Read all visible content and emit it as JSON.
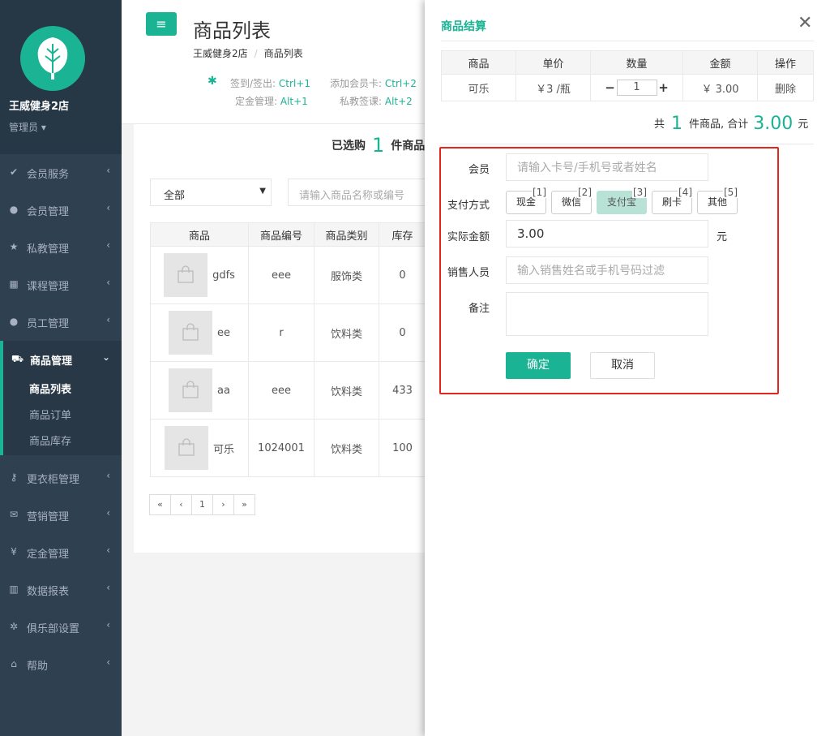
{
  "sidebar": {
    "shop_name": "王威健身2店",
    "role": "管理员",
    "items": [
      {
        "label": "会员服务",
        "icon": "check-icon"
      },
      {
        "label": "会员管理",
        "icon": "user-icon"
      },
      {
        "label": "私教管理",
        "icon": "star-icon"
      },
      {
        "label": "课程管理",
        "icon": "calendar-icon"
      },
      {
        "label": "员工管理",
        "icon": "users-icon"
      },
      {
        "label": "商品管理",
        "icon": "cart-icon"
      },
      {
        "label": "更衣柜管理",
        "icon": "key-icon"
      },
      {
        "label": "营销管理",
        "icon": "envelope-icon"
      },
      {
        "label": "定金管理",
        "icon": "yen-icon"
      },
      {
        "label": "数据报表",
        "icon": "bar-chart-icon"
      },
      {
        "label": "俱乐部设置",
        "icon": "cog-icon"
      },
      {
        "label": "帮助",
        "icon": "graduation-cap-icon"
      }
    ],
    "sub_items": [
      "商品列表",
      "商品订单",
      "商品库存"
    ]
  },
  "header": {
    "title": "商品列表",
    "breadcrumb": [
      "王威健身2店",
      "商品列表"
    ],
    "shortcuts": [
      {
        "label": "签到/签出:",
        "key": "Ctrl+1"
      },
      {
        "label": "添加会员卡:",
        "key": "Ctrl+2"
      },
      {
        "label": "定金管理:",
        "key": "Alt+1"
      },
      {
        "label": "私教签课:",
        "key": "Alt+2"
      }
    ]
  },
  "main": {
    "selected_prefix": "已选购",
    "selected_count": "1",
    "selected_suffix": "件商品",
    "filter_value": "全部",
    "search_placeholder": "请输入商品名称或编号",
    "columns": [
      "商品",
      "商品编号",
      "商品类别",
      "库存"
    ],
    "rows": [
      {
        "name": "gdfs",
        "code": "eee",
        "category": "服饰类",
        "stock": "0"
      },
      {
        "name": "ee",
        "code": "r",
        "category": "饮料类",
        "stock": "0"
      },
      {
        "name": "aa",
        "code": "eee",
        "category": "饮料类",
        "stock": "433"
      },
      {
        "name": "可乐",
        "code": "1024001",
        "category": "饮料类",
        "stock": "100"
      }
    ],
    "pager": [
      "«",
      "‹",
      "1",
      "›",
      "»"
    ]
  },
  "checkout": {
    "title": "商品结算",
    "columns": [
      "商品",
      "单价",
      "数量",
      "金额",
      "操作"
    ],
    "item": {
      "name": "可乐",
      "price": "￥3 /瓶",
      "qty": "1",
      "amount": "￥ 3.00",
      "action": "删除"
    },
    "total_prefix": "共",
    "total_count": "1",
    "total_mid": "件商品,  合计",
    "total_amount": "3.00",
    "total_unit": "元",
    "form": {
      "member_label": "会员",
      "member_placeholder": "请输入卡号/手机号或者姓名",
      "pay_label": "支付方式",
      "pay_methods": [
        {
          "label": "现金",
          "key": "[1]"
        },
        {
          "label": "微信",
          "key": "[2]"
        },
        {
          "label": "支付宝",
          "key": "[3]"
        },
        {
          "label": "刷卡",
          "key": "[4]"
        },
        {
          "label": "其他",
          "key": "[5]"
        }
      ],
      "selected_pay": "支付宝",
      "amount_label": "实际金额",
      "amount_value": "3.00",
      "amount_unit": "元",
      "seller_label": "销售人员",
      "seller_placeholder": "输入销售姓名或手机号码过滤",
      "remark_label": "备注",
      "confirm": "确定",
      "cancel": "取消"
    }
  }
}
